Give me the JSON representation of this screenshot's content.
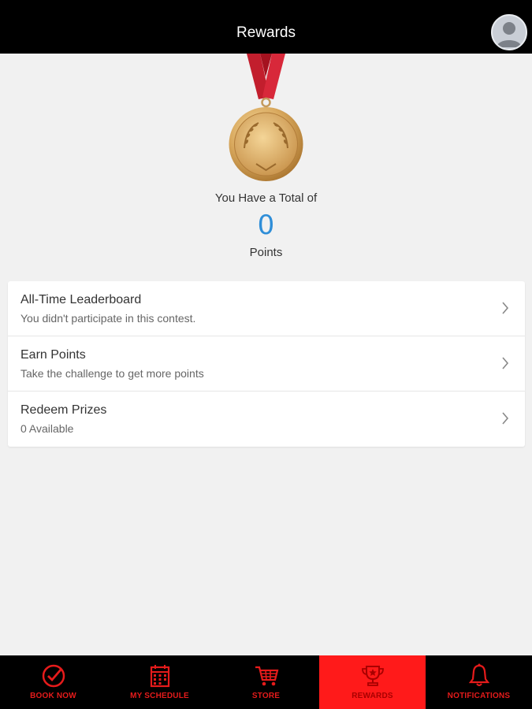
{
  "header": {
    "title": "Rewards",
    "avatar_icon": "user-avatar-icon"
  },
  "summary": {
    "label": "You Have a Total of",
    "points": "0",
    "unit": "Points",
    "medal_icon": "gold-medal-icon"
  },
  "menu": {
    "items": [
      {
        "title": "All-Time Leaderboard",
        "subtitle": "You didn't participate in this contest."
      },
      {
        "title": "Earn Points",
        "subtitle": "Take the challenge to get more points"
      },
      {
        "title": "Redeem Prizes",
        "subtitle": "0 Available"
      }
    ]
  },
  "nav": {
    "items": [
      {
        "label": "BOOK NOW",
        "icon": "check-circle-icon"
      },
      {
        "label": "MY SCHEDULE",
        "icon": "calendar-icon"
      },
      {
        "label": "STORE",
        "icon": "cart-icon"
      },
      {
        "label": "REWARDS",
        "icon": "trophy-icon",
        "active": true
      },
      {
        "label": "NOTIFICATIONS",
        "icon": "bell-icon"
      }
    ]
  },
  "colors": {
    "accent": "#ff1a1a",
    "nav_label": "#e51b1b",
    "points": "#2f8ed8",
    "header_bg": "#000000"
  }
}
